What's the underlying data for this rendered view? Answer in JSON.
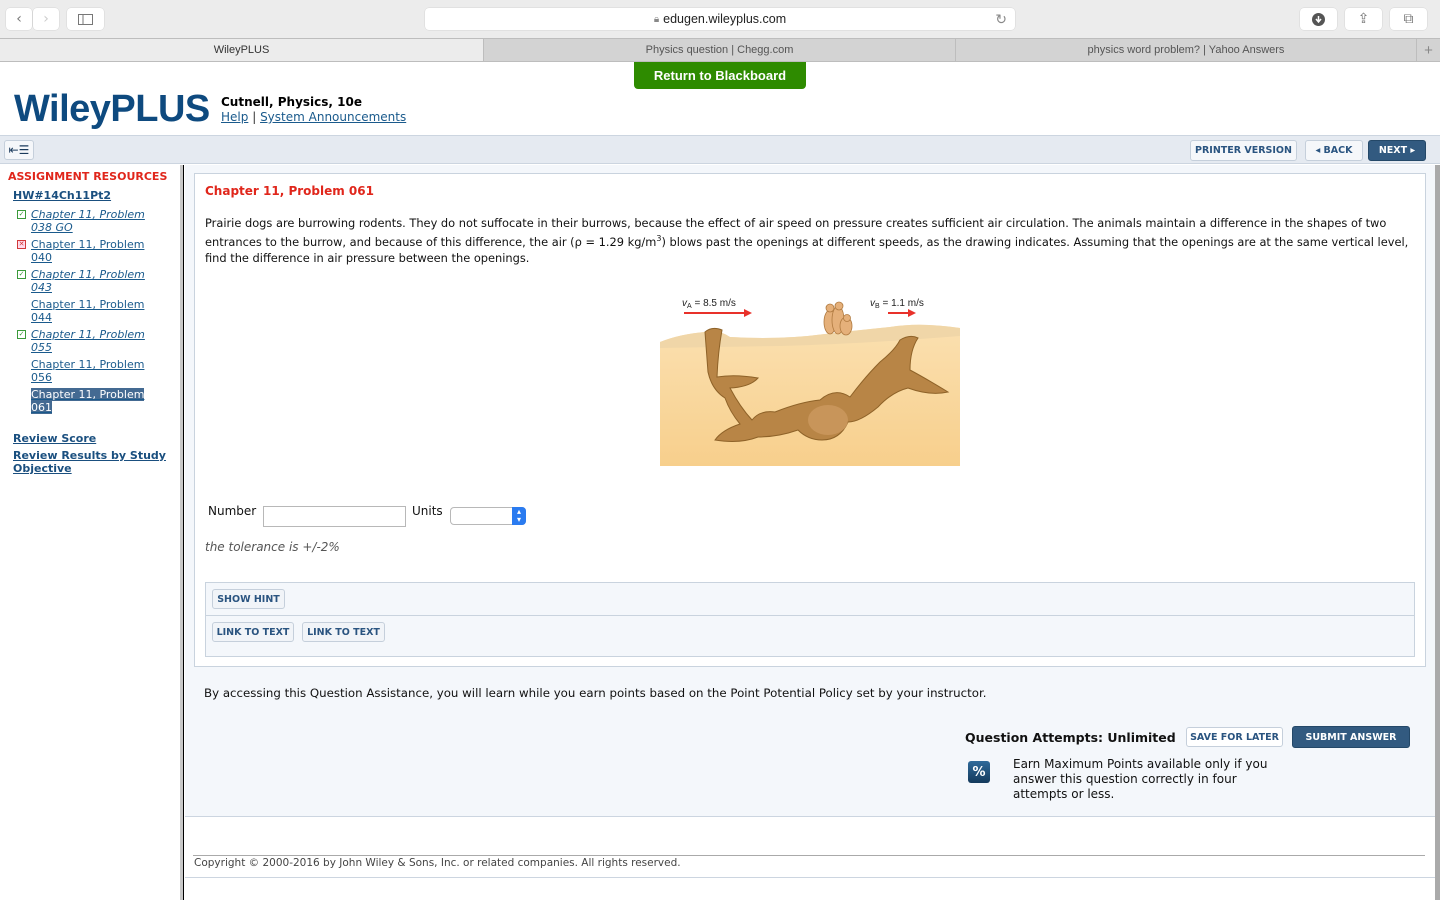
{
  "browser": {
    "url": "edugen.wileyplus.com",
    "tabs": [
      {
        "label": "WileyPLUS",
        "active": true
      },
      {
        "label": "Physics question | Chegg.com",
        "active": false
      },
      {
        "label": "physics word problem? | Yahoo Answers",
        "active": false
      }
    ],
    "new_tab": "+"
  },
  "header": {
    "return_button": "Return to Blackboard",
    "logo": "WileyPLUS",
    "course": "Cutnell, Physics, 10e",
    "help": "Help",
    "separator": "|",
    "announcements": "System Announcements"
  },
  "navbar": {
    "printer": "PRINTER VERSION",
    "back": "◂ BACK",
    "next": "NEXT ▸"
  },
  "sidebar": {
    "title": "ASSIGNMENT RESOURCES",
    "assignment": "HW#14Ch11Pt2",
    "items": [
      {
        "line1": "Chapter 11, Problem",
        "line2": "038 GO",
        "status": "correct",
        "italic": true
      },
      {
        "line1": "Chapter 11, Problem",
        "line2": "040",
        "status": "incorrect",
        "italic": false
      },
      {
        "line1": "Chapter 11, Problem",
        "line2": "043",
        "status": "correct",
        "italic": true
      },
      {
        "line1": "Chapter 11, Problem",
        "line2": "044",
        "status": "none",
        "italic": false
      },
      {
        "line1": "Chapter 11, Problem",
        "line2": "055",
        "status": "correct",
        "italic": true
      },
      {
        "line1": "Chapter 11, Problem",
        "line2": "056",
        "status": "none",
        "italic": false
      },
      {
        "line1": "Chapter 11, Problem",
        "line2": "061",
        "status": "selected",
        "italic": false
      }
    ],
    "review_score": "Review Score",
    "review_results": "Review Results by Study Objective"
  },
  "question": {
    "title": "Chapter 11, Problem 061",
    "text_part1": "Prairie dogs are burrowing rodents. They do not suffocate in their burrows, because the effect of air speed on pressure creates sufficient air circulation. The animals maintain a difference in the shapes of two entrances to the burrow, and because of this difference, the air (ρ = 1.29 kg/m",
    "text_sup": "3",
    "text_part2": ") blows past the openings at different speeds, as the drawing indicates. Assuming that the openings are at the same vertical level, find the difference in air pressure between the openings.",
    "figure": {
      "va_label": "vA = 8.5 m/s",
      "va_sym": "v",
      "va_sub": "A",
      "va_val": " = 8.5 m/s",
      "vb_sym": "v",
      "vb_sub": "B",
      "vb_val": " = 1.1 m/s"
    },
    "number_label": "Number",
    "number_value": "",
    "units_label": "Units",
    "units_value": "",
    "tolerance": "the tolerance is +/-2%",
    "show_hint": "SHOW HINT",
    "link_text_1": "LINK TO TEXT",
    "link_text_2": "LINK TO TEXT"
  },
  "assistance": {
    "text": "By accessing this Question Assistance, you will learn while you earn points based on the Point Potential Policy set by your instructor.",
    "attempts": "Question Attempts: Unlimited",
    "save": "SAVE FOR LATER",
    "submit": "SUBMIT ANSWER",
    "pct_icon": "%",
    "earn": "Earn Maximum Points available only if you answer this question correctly in four attempts or less."
  },
  "footer": {
    "copyright": "Copyright © 2000-2016 by John Wiley & Sons, Inc. or related companies. All rights reserved."
  }
}
